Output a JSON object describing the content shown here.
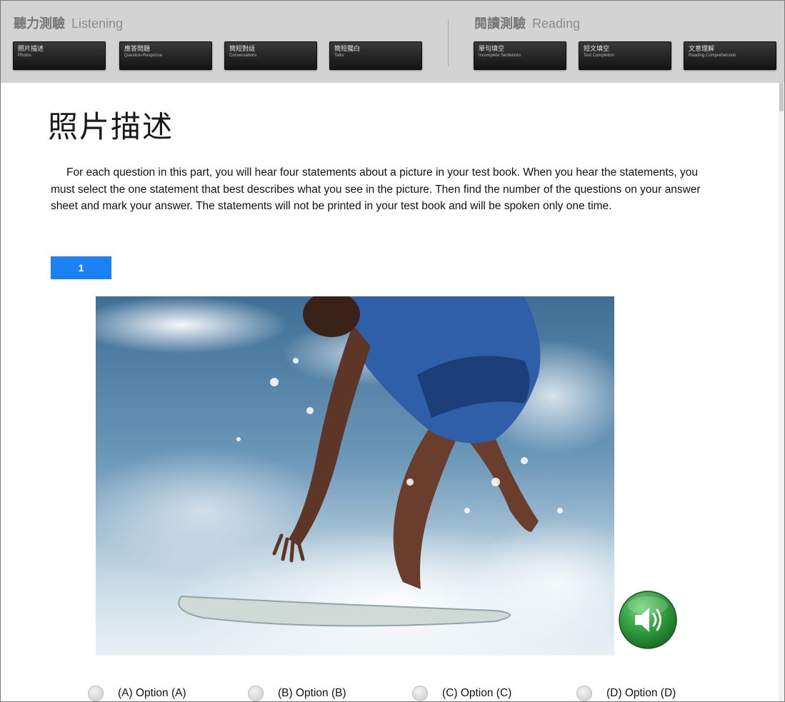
{
  "nav": {
    "listening": {
      "title_zh": "聽力測驗",
      "title_en": "Listening",
      "buttons": [
        {
          "zh": "照片描述",
          "en": "Photos"
        },
        {
          "zh": "應答問題",
          "en": "Question-Response"
        },
        {
          "zh": "簡短對話",
          "en": "Conversations"
        },
        {
          "zh": "簡短獨白",
          "en": "Talks"
        }
      ]
    },
    "reading": {
      "title_zh": "閱讀測驗",
      "title_en": "Reading",
      "buttons": [
        {
          "zh": "單句填空",
          "en": "Incomplete Sentences"
        },
        {
          "zh": "短文填空",
          "en": "Text Completion"
        },
        {
          "zh": "文意理解",
          "en": "Reading Comprehension"
        }
      ]
    }
  },
  "main": {
    "title": "照片描述",
    "instructions": "For each question in this part, you will hear four statements about a picture in your test book. When you hear the statements, you must select the one statement that best describes what you see in the picture. Then find the number of the questions on your answer sheet and mark your answer. The statements will not be printed in your test book and will be spoken only one time.",
    "question_number": "1",
    "photo_icon": "surfer-photo",
    "audio_icon": "speaker-play-icon",
    "options": [
      {
        "label": "(A) Option (A)"
      },
      {
        "label": "(B) Option (B)"
      },
      {
        "label": "(C) Option (C)"
      },
      {
        "label": "(D) Option (D)"
      }
    ]
  },
  "colors": {
    "nav_bg": "#d3d3d3",
    "nav_button": "#1e1e1e",
    "question_badge": "#1a82f5",
    "audio_button": "#2f9a3c"
  }
}
